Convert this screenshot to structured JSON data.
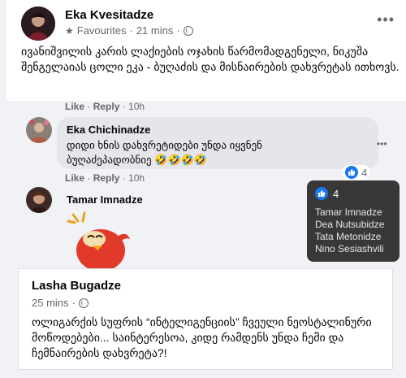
{
  "post": {
    "author": "Eka Kvesitadze",
    "audience": "Favourites",
    "time": "21 mins",
    "separator": "·",
    "more": "•••",
    "text": "ივანიშვილის კარის ლაქიების ოჯახის წარმომადგენელი, ნიკუშა შენგელაიას ცოლი ეკა -   ბუღაძის და მისნაირების  დახვრეტას ითხოვს."
  },
  "comment_prev": {
    "like": "Like",
    "reply": "Reply",
    "time": "10h"
  },
  "comment1": {
    "author": "Eka Chichinadze",
    "text": "დიდი ხნის დახვრეტიდები უნდა იყვნენ ბუღაძეპადობნიე 🤣🤣🤣🤣",
    "like": "Like",
    "reply": "Reply",
    "time": "10h",
    "reaction_count": "4",
    "more": "•••"
  },
  "comment2": {
    "author": "Tamar Imnadze"
  },
  "tooltip": {
    "count": "4",
    "names": [
      "Tamar Imnadze",
      "Dea Nutsubidze",
      "Tata Metonidze",
      "Nino Sesiashvili"
    ]
  },
  "reshare": {
    "author": "Lasha Bugadze",
    "time": "25 mins",
    "separator": "·",
    "text": "ოლიგარქის სუფრის “ინტელიგენციის” ჩვეული ნეოსტალინური მოწოდებები... საინტერესოა, კიდე რამდენს უნდა ჩემი და ჩემნაირების დახვრეტა?!"
  },
  "colors": {
    "like_blue": "#1877f2",
    "meta_gray": "#65676b",
    "bubble_gray": "#e4e6eb"
  }
}
